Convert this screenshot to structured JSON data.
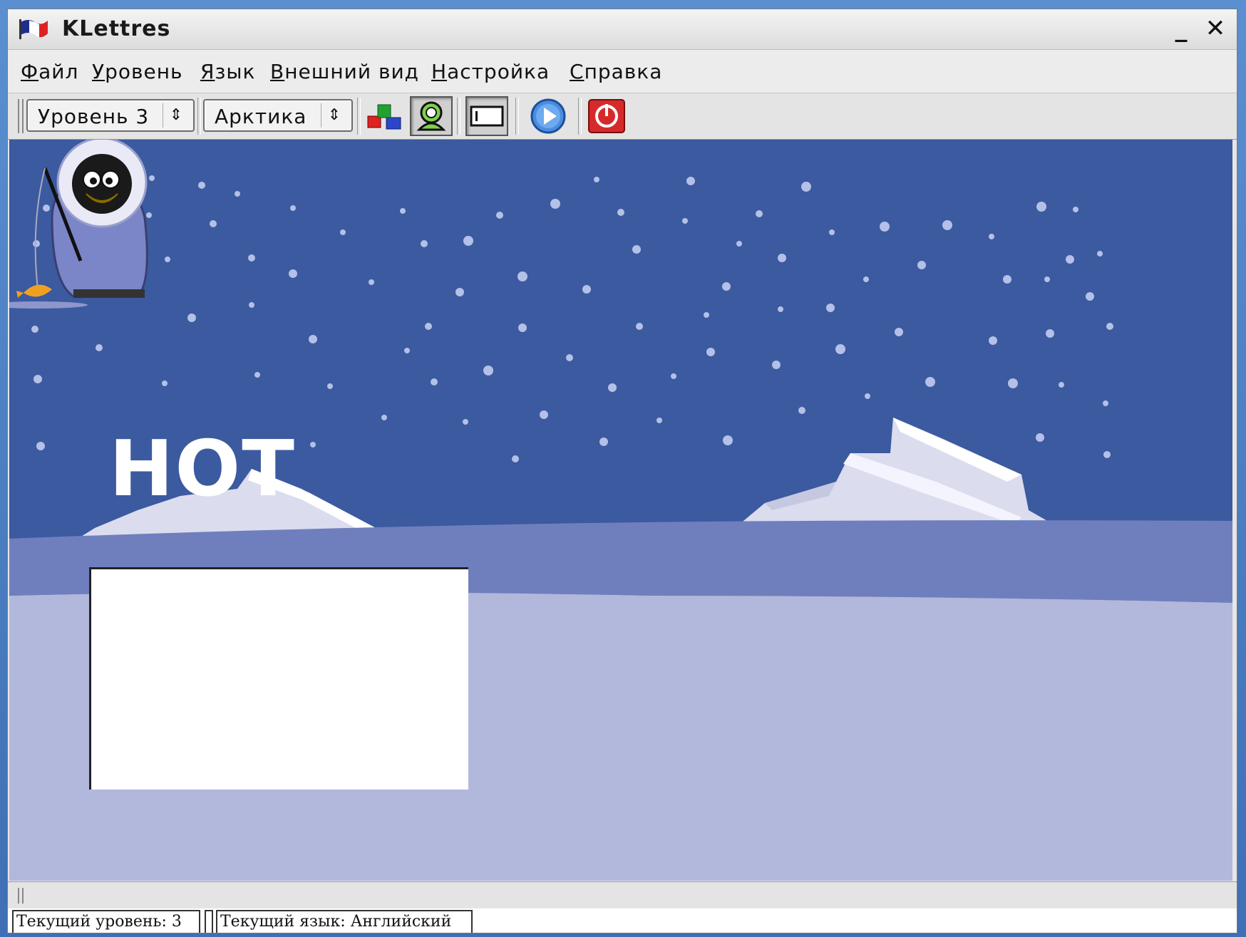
{
  "window": {
    "title": "KLettres"
  },
  "window_controls": {
    "minimize": "_",
    "close": "✕"
  },
  "menu": [
    {
      "accel": "Ф",
      "rest": "айл"
    },
    {
      "accel": "У",
      "rest": "ровень"
    },
    {
      "accel": "Я",
      "rest": "зык"
    },
    {
      "accel": "В",
      "rest": "нешний вид"
    },
    {
      "accel": "Н",
      "rest": "астройка"
    },
    {
      "accel": "С",
      "rest": "правка"
    }
  ],
  "toolbar": {
    "level_combo": "Уровень 3",
    "theme_combo": "Арктика",
    "spin_glyph": "⇕",
    "buttons": [
      "kids-mode-icon",
      "grownup-mode-icon",
      "show-menubar-icon",
      "next-icon",
      "quit-icon"
    ]
  },
  "game": {
    "word": "НОТ",
    "input_value": "",
    "colors": {
      "sky": "#3b5aa0",
      "ice_far": "#6f7fbd",
      "ice_near": "#b2b8dc",
      "iceberg": "#dcdcef"
    }
  },
  "statusbar": {
    "level": "Текущий уровень: 3",
    "language": "Текущий язык: Английский"
  }
}
